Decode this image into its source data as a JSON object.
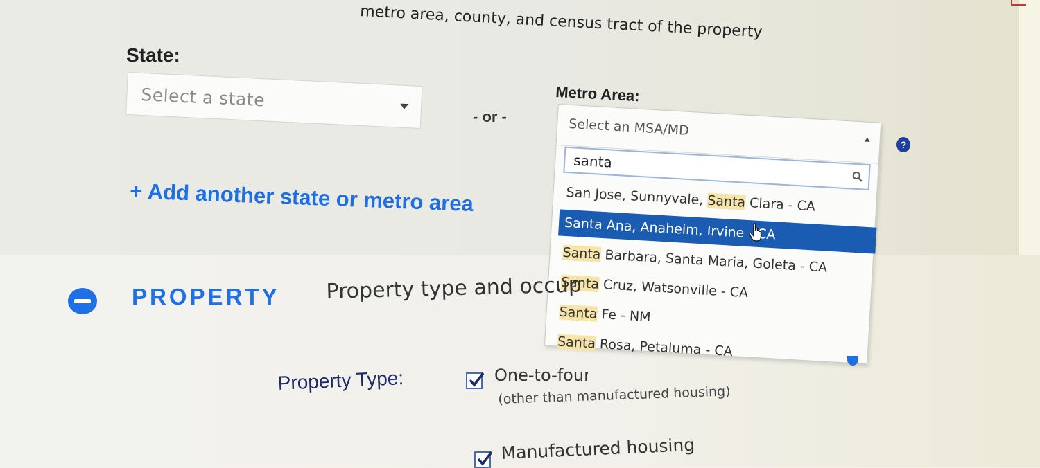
{
  "intro": {
    "text": "metro area, county, and census tract of the property"
  },
  "location": {
    "state_label": "State:",
    "state_placeholder": "Select a state",
    "or_text": "- or -",
    "metro_label": "Metro Area:",
    "metro_placeholder": "Select an MSA/MD",
    "search_value": "santa",
    "add_link": "+ Add another state or metro area",
    "help": "?",
    "results": [
      {
        "pre": "San Jose, Sunnyvale, ",
        "match": "Santa",
        "post": " Clara - CA",
        "selected": false
      },
      {
        "pre": "",
        "match": "Santa",
        "post": " Ana, Anaheim, Irvine - CA",
        "selected": true
      },
      {
        "pre": "",
        "match": "Santa",
        "post": " Barbara, Santa Maria, Goleta - CA",
        "selected": false
      },
      {
        "pre": "",
        "match": "Santa",
        "post": " Cruz, Watsonville - CA",
        "selected": false
      },
      {
        "pre": "",
        "match": "Santa",
        "post": " Fe - NM",
        "selected": false
      },
      {
        "pre": "",
        "match": "Santa",
        "post": " Rosa, Petaluma - CA",
        "selected": false
      }
    ]
  },
  "property": {
    "title": "PROPERTY",
    "subtitle": "Property type and occupancy",
    "type_label": "Property Type:",
    "option1": "One-to-four",
    "option1_sub": "(other than manufactured housing)",
    "option2": "Manufactured housing"
  },
  "colors": {
    "accent": "#1f70e6",
    "selected_row": "#1b5cb3",
    "match_highlight": "#f6e4a8"
  },
  "icons": [
    "chevron-down-icon",
    "chevron-up-icon",
    "search-icon",
    "help-icon",
    "collapse-minus-icon",
    "checkbox-checked-icon",
    "hand-cursor-icon"
  ]
}
